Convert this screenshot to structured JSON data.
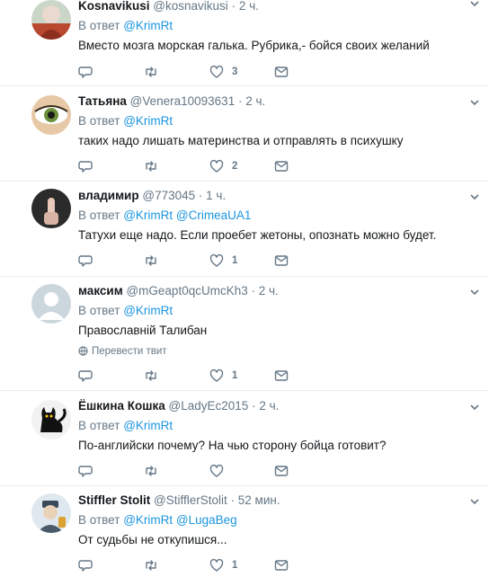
{
  "tweets": [
    {
      "name": "Kosnavikusi",
      "handle": "@kosnavikusi",
      "time": "2 ч.",
      "reply_prefix": "В ответ",
      "reply_to": [
        "@KrimRt"
      ],
      "text": "Вместо мозга морская галька. Рубрика,- бойся своих желаний",
      "likes": "3",
      "translate": ""
    },
    {
      "name": "Татьяна",
      "handle": "@Venera10093631",
      "time": "2 ч.",
      "reply_prefix": "В ответ",
      "reply_to": [
        "@KrimRt"
      ],
      "text": "таких надо лишать материнства и отправлять в психушку",
      "likes": "2",
      "translate": ""
    },
    {
      "name": "владимир",
      "handle": "@773045",
      "time": "1 ч.",
      "reply_prefix": "В ответ",
      "reply_to": [
        "@KrimRt",
        "@CrimeaUA1"
      ],
      "text": "Татухи еще надо. Если проебет жетоны, опознать можно будет.",
      "likes": "1",
      "translate": ""
    },
    {
      "name": "максим",
      "handle": "@mGeapt0qcUmcKh3",
      "time": "2 ч.",
      "reply_prefix": "В ответ",
      "reply_to": [
        "@KrimRt"
      ],
      "text": "Православній Талибан",
      "likes": "1",
      "translate": "Перевести твит"
    },
    {
      "name": "Ёшкина Кошка",
      "handle": "@LadyEc2015",
      "time": "2 ч.",
      "reply_prefix": "В ответ",
      "reply_to": [
        "@KrimRt"
      ],
      "text": "По-английски почему? На чью сторону бойца готовит?",
      "likes": "",
      "translate": ""
    },
    {
      "name": "Stiffler Stolit",
      "handle": "@StifflerStolit",
      "time": "52 мин.",
      "reply_prefix": "В ответ",
      "reply_to": [
        "@KrimRt",
        "@LugaBeg"
      ],
      "text": "От судьбы не откупишся...",
      "likes": "1",
      "translate": ""
    }
  ],
  "separator": "·",
  "colors": {
    "link": "#1b95e0",
    "muted": "#657786",
    "text": "#14171a",
    "divider": "#e6ecf0"
  },
  "icons": [
    "reply-icon",
    "retweet-icon",
    "like-icon",
    "message-icon",
    "caret-down-icon",
    "globe-icon"
  ]
}
